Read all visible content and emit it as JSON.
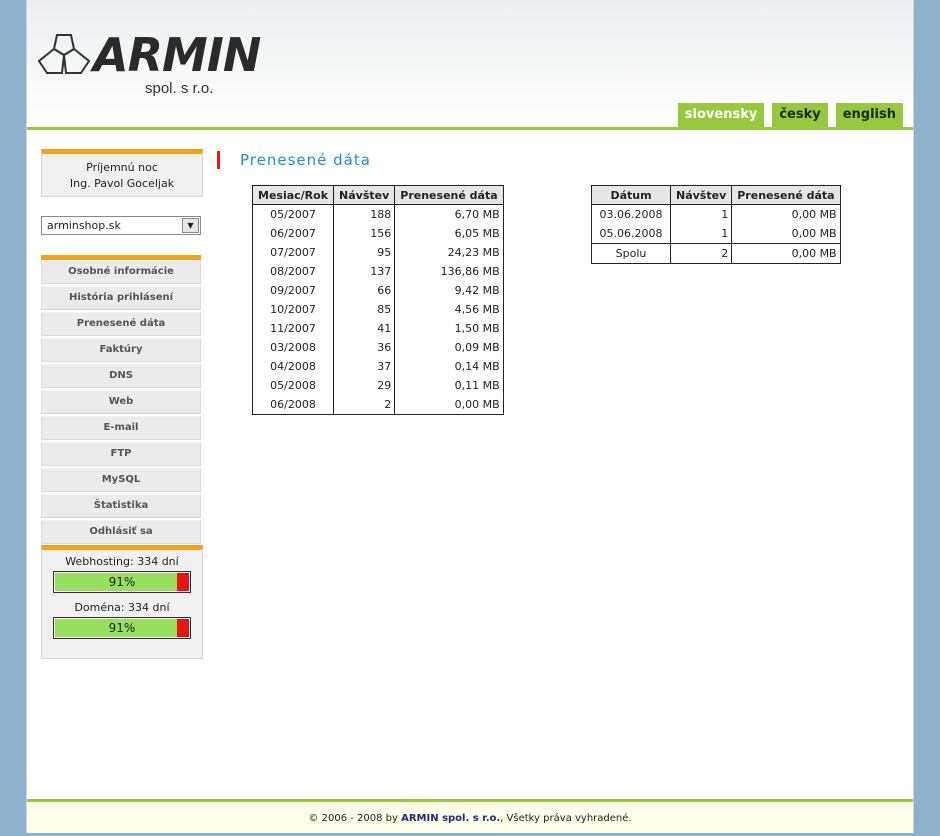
{
  "header": {
    "logo_text": "ARMIN",
    "logo_sub": "spol. s r.o.",
    "languages": [
      "slovensky",
      "česky",
      "english"
    ]
  },
  "user": {
    "greeting": "Príjemnú noc",
    "name": "Ing. Pavol Goceljak"
  },
  "domain_select": {
    "value": "arminshop.sk"
  },
  "menu": [
    "Osobné informácie",
    "História prihlásení",
    "Prenesené dáta",
    "Faktúry",
    "DNS",
    "Web",
    "E-mail",
    "FTP",
    "MySQL",
    "Štatistika",
    "Odhlásiť sa"
  ],
  "status": {
    "webhosting_label": "Webhosting: 334 dní",
    "webhosting_percent": "91%",
    "webhosting_fraction": 0.91,
    "domain_label": "Doména: 334 dní",
    "domain_percent": "91%",
    "domain_fraction": 0.91
  },
  "main": {
    "title": "Prenesené dáta",
    "monthly": {
      "headers": [
        "Mesiac/Rok",
        "Návštev",
        "Prenesené dáta"
      ],
      "rows": [
        [
          "05/2007",
          "188",
          "6,70 MB"
        ],
        [
          "06/2007",
          "156",
          "6,05 MB"
        ],
        [
          "07/2007",
          "95",
          "24,23 MB"
        ],
        [
          "08/2007",
          "137",
          "136,86 MB"
        ],
        [
          "09/2007",
          "66",
          "9,42 MB"
        ],
        [
          "10/2007",
          "85",
          "4,56 MB"
        ],
        [
          "11/2007",
          "41",
          "1,50 MB"
        ],
        [
          "03/2008",
          "36",
          "0,09 MB"
        ],
        [
          "04/2008",
          "37",
          "0,14 MB"
        ],
        [
          "05/2008",
          "29",
          "0,11 MB"
        ],
        [
          "06/2008",
          "2",
          "0,00 MB"
        ]
      ]
    },
    "daily": {
      "headers": [
        "Dátum",
        "Návštev",
        "Prenesené dáta"
      ],
      "rows": [
        [
          "03.06.2008",
          "1",
          "0,00 MB"
        ],
        [
          "05.06.2008",
          "1",
          "0,00 MB"
        ]
      ],
      "total": [
        "Spolu",
        "2",
        "0,00 MB"
      ]
    }
  },
  "footer": {
    "prefix": "© 2006 - 2008 by",
    "company": "ARMIN spol. s r.o.",
    "suffix": ", Všetky práva vyhradené."
  },
  "colors": {
    "accent_green": "#96c93d",
    "orange": "#f5a21b",
    "title_blue": "#1d8fd8",
    "red_marker": "#e21a1a"
  }
}
